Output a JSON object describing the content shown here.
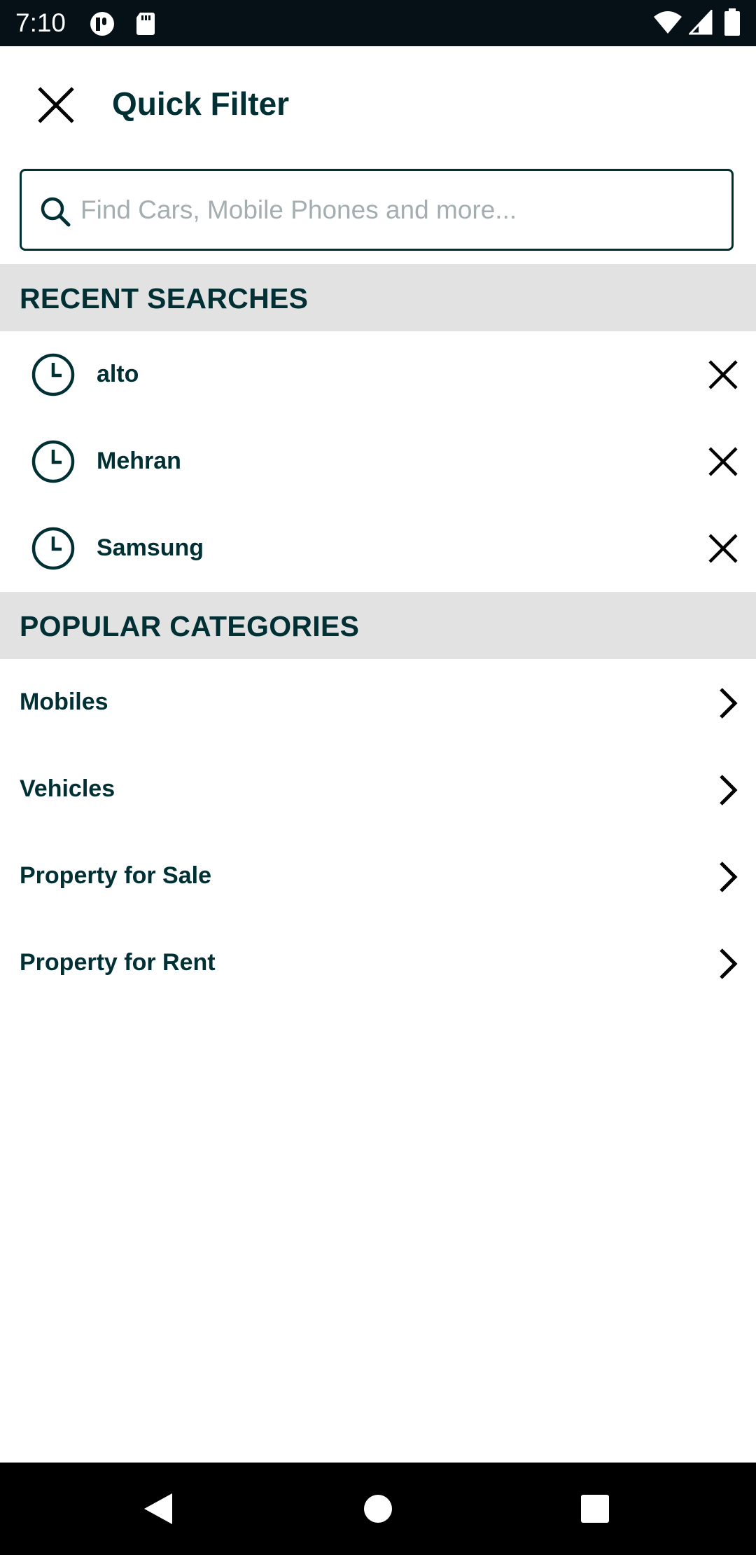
{
  "status_bar": {
    "time": "7:10",
    "left_icons": [
      "app-notification-icon",
      "sd-card-icon"
    ],
    "right_icons": [
      "wifi-icon",
      "signal-icon",
      "battery-icon"
    ]
  },
  "header": {
    "title": "Quick Filter",
    "close_icon": "close-icon"
  },
  "search": {
    "placeholder": "Find Cars, Mobile Phones and more...",
    "value": "",
    "icon": "search-icon"
  },
  "recent_searches": {
    "title": "RECENT SEARCHES",
    "items": [
      {
        "label": "alto"
      },
      {
        "label": "Mehran"
      },
      {
        "label": "Samsung"
      }
    ]
  },
  "popular_categories": {
    "title": "POPULAR CATEGORIES",
    "items": [
      {
        "label": "Mobiles"
      },
      {
        "label": "Vehicles"
      },
      {
        "label": "Property for Sale"
      },
      {
        "label": "Property for Rent"
      }
    ]
  },
  "colors": {
    "primary_text": "#002f34",
    "section_background": "#e2e2e2",
    "status_bar": "#051117",
    "nav_bar": "#000000"
  }
}
